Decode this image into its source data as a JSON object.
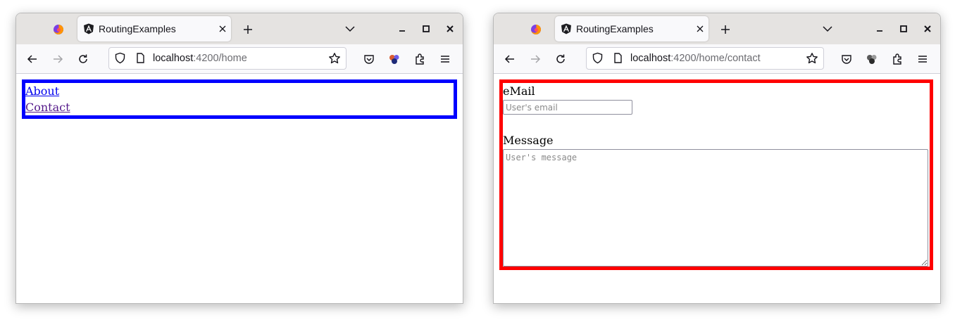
{
  "windows": [
    {
      "tab_title": "RoutingExamples",
      "url_host": "localhost",
      "url_path": ":4200/home",
      "page": {
        "links": [
          "About",
          "Contact"
        ],
        "frame_color": "#0000ff"
      }
    },
    {
      "tab_title": "RoutingExamples",
      "url_host": "localhost",
      "url_path": ":4200/home/contact",
      "page": {
        "email_label": "eMail",
        "email_placeholder": "User's email",
        "message_label": "Message",
        "message_placeholder": "User's message",
        "frame_color": "#ff0000"
      }
    }
  ],
  "icons": [
    "firefox-icon",
    "angular-icon",
    "close-tab-icon",
    "new-tab-icon",
    "list-tabs-icon",
    "minimize-icon",
    "maximize-icon",
    "close-window-icon",
    "back-icon",
    "forward-icon",
    "reload-icon",
    "shield-icon",
    "page-icon",
    "bookmark-star-icon",
    "pocket-icon",
    "extensions-icon",
    "menu-icon"
  ]
}
